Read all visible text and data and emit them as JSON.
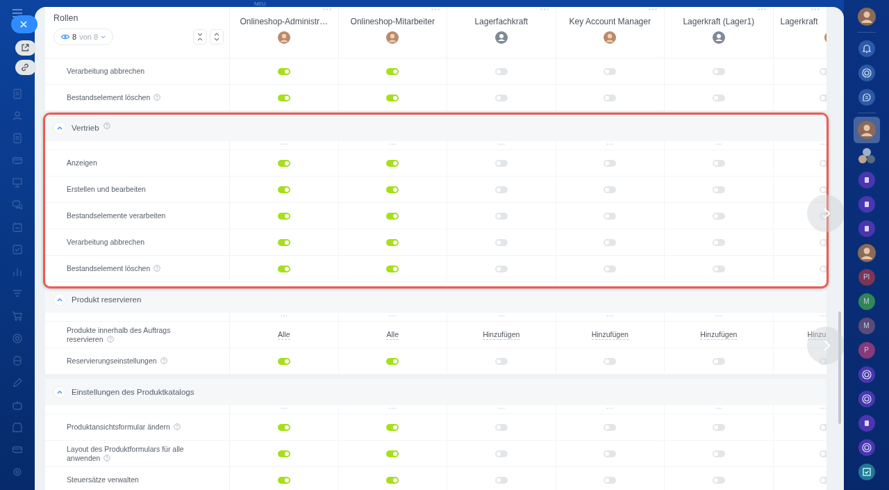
{
  "top_label": "NEU",
  "header_title": "Rollen",
  "filter": {
    "count": "8",
    "total": "von 8"
  },
  "roles": [
    {
      "name": "Onlineshop-Administr…",
      "kind": "photo"
    },
    {
      "name": "Onlineshop-Mitarbeiter",
      "kind": "photo"
    },
    {
      "name": "Lagerfachkraft",
      "kind": "placeholder"
    },
    {
      "name": "Key Account Manager",
      "kind": "photo"
    },
    {
      "name": "Lagerkraft (Lager1)",
      "kind": "placeholder"
    },
    {
      "name": "Lagerkraft",
      "kind": "photo"
    }
  ],
  "sections": [
    {
      "highlighted": false,
      "rows": [
        {
          "label": "Verarbeitung abbrechen",
          "help": false,
          "cells": [
            {
              "kind": "toggle",
              "on": true
            },
            {
              "kind": "toggle",
              "on": true
            },
            {
              "kind": "toggle",
              "on": false
            },
            {
              "kind": "toggle",
              "on": false
            },
            {
              "kind": "toggle",
              "on": false
            },
            {
              "kind": "toggle",
              "on": false
            }
          ]
        },
        {
          "label": "Bestandselement löschen",
          "help": true,
          "cells": [
            {
              "kind": "toggle",
              "on": true
            },
            {
              "kind": "toggle",
              "on": true
            },
            {
              "kind": "toggle",
              "on": false
            },
            {
              "kind": "toggle",
              "on": false
            },
            {
              "kind": "toggle",
              "on": false
            },
            {
              "kind": "toggle",
              "on": false
            }
          ]
        }
      ]
    },
    {
      "title": "Vertrieb",
      "help": true,
      "expanded": true,
      "highlighted": true,
      "rows": [
        {
          "label": "Anzeigen",
          "help": false,
          "cells": [
            {
              "kind": "toggle",
              "on": true
            },
            {
              "kind": "toggle",
              "on": true
            },
            {
              "kind": "toggle",
              "on": false
            },
            {
              "kind": "toggle",
              "on": false
            },
            {
              "kind": "toggle",
              "on": false
            },
            {
              "kind": "toggle",
              "on": false
            }
          ]
        },
        {
          "label": "Erstellen und bearbeiten",
          "help": false,
          "cells": [
            {
              "kind": "toggle",
              "on": true
            },
            {
              "kind": "toggle",
              "on": true
            },
            {
              "kind": "toggle",
              "on": false
            },
            {
              "kind": "toggle",
              "on": false
            },
            {
              "kind": "toggle",
              "on": false
            },
            {
              "kind": "toggle",
              "on": false
            }
          ]
        },
        {
          "label": "Bestandselemente verarbeiten",
          "help": false,
          "cells": [
            {
              "kind": "toggle",
              "on": true
            },
            {
              "kind": "toggle",
              "on": true
            },
            {
              "kind": "toggle",
              "on": false
            },
            {
              "kind": "toggle",
              "on": false
            },
            {
              "kind": "toggle",
              "on": false
            },
            {
              "kind": "toggle",
              "on": false
            }
          ]
        },
        {
          "label": "Verarbeitung abbrechen",
          "help": false,
          "cells": [
            {
              "kind": "toggle",
              "on": true
            },
            {
              "kind": "toggle",
              "on": true
            },
            {
              "kind": "toggle",
              "on": false
            },
            {
              "kind": "toggle",
              "on": false
            },
            {
              "kind": "toggle",
              "on": false
            },
            {
              "kind": "toggle",
              "on": false
            }
          ]
        },
        {
          "label": "Bestandselement löschen",
          "help": true,
          "cells": [
            {
              "kind": "toggle",
              "on": true
            },
            {
              "kind": "toggle",
              "on": true
            },
            {
              "kind": "toggle",
              "on": false
            },
            {
              "kind": "toggle",
              "on": false
            },
            {
              "kind": "toggle",
              "on": false
            },
            {
              "kind": "toggle",
              "on": false
            }
          ]
        }
      ]
    },
    {
      "title": "Produkt reservieren",
      "help": false,
      "expanded": true,
      "highlighted": false,
      "rows": [
        {
          "label": "Produkte innerhalb des Auftrags reservieren",
          "help": true,
          "cells": [
            {
              "kind": "text",
              "value": "Alle"
            },
            {
              "kind": "text",
              "value": "Alle"
            },
            {
              "kind": "text",
              "value": "Hinzufügen"
            },
            {
              "kind": "text",
              "value": "Hinzufügen"
            },
            {
              "kind": "text",
              "value": "Hinzufügen"
            },
            {
              "kind": "text",
              "value": "Hinzu"
            }
          ]
        },
        {
          "label": "Reservierungseinstellungen",
          "help": true,
          "cells": [
            {
              "kind": "toggle",
              "on": true
            },
            {
              "kind": "toggle",
              "on": true
            },
            {
              "kind": "toggle",
              "on": false
            },
            {
              "kind": "toggle",
              "on": false
            },
            {
              "kind": "toggle",
              "on": false
            },
            {
              "kind": "toggle",
              "on": false
            }
          ]
        }
      ]
    },
    {
      "title": "Einstellungen des Produktkatalogs",
      "help": false,
      "expanded": true,
      "highlighted": false,
      "rows": [
        {
          "label": "Produktansichtsformular ändern",
          "help": true,
          "cells": [
            {
              "kind": "toggle",
              "on": true
            },
            {
              "kind": "toggle",
              "on": true
            },
            {
              "kind": "toggle",
              "on": false
            },
            {
              "kind": "toggle",
              "on": false
            },
            {
              "kind": "toggle",
              "on": false
            },
            {
              "kind": "toggle",
              "on": false
            }
          ]
        },
        {
          "label": "Layout des Produktformulars für alle anwenden",
          "help": true,
          "cells": [
            {
              "kind": "toggle",
              "on": true
            },
            {
              "kind": "toggle",
              "on": true
            },
            {
              "kind": "toggle",
              "on": false
            },
            {
              "kind": "toggle",
              "on": false
            },
            {
              "kind": "toggle",
              "on": false
            },
            {
              "kind": "toggle",
              "on": false
            }
          ]
        },
        {
          "label": "Steuersätze verwalten",
          "help": false,
          "cells": [
            {
              "kind": "toggle",
              "on": true
            },
            {
              "kind": "toggle",
              "on": true
            },
            {
              "kind": "toggle",
              "on": false
            },
            {
              "kind": "toggle",
              "on": false
            },
            {
              "kind": "toggle",
              "on": false
            },
            {
              "kind": "toggle",
              "on": false
            }
          ]
        }
      ]
    }
  ],
  "right_bar": [
    [
      {
        "kind": "avatar",
        "selected": false
      }
    ],
    [
      {
        "kind": "bell",
        "selected": false
      },
      {
        "kind": "swirl",
        "selected": false
      },
      {
        "kind": "chat",
        "selected": false
      }
    ],
    [
      {
        "kind": "avatar",
        "selected": true
      },
      {
        "kind": "group",
        "selected": false
      },
      {
        "kind": "contact",
        "selected": false
      },
      {
        "kind": "contact",
        "selected": false
      },
      {
        "kind": "contact",
        "selected": false
      },
      {
        "kind": "avatar",
        "selected": false
      },
      {
        "kind": "initials",
        "text": "Pl",
        "color": "#7a3656",
        "selected": false
      },
      {
        "kind": "initials",
        "text": "M",
        "color": "#2f8656",
        "selected": false
      },
      {
        "kind": "initials",
        "text": "M",
        "color": "#5a4c78",
        "selected": false
      },
      {
        "kind": "initials",
        "text": "P",
        "color": "#873a78",
        "selected": false
      },
      {
        "kind": "swirl",
        "selected": false
      },
      {
        "kind": "swirl",
        "selected": false
      },
      {
        "kind": "contact",
        "selected": false
      },
      {
        "kind": "swirl",
        "selected": false
      },
      {
        "kind": "task",
        "selected": false
      }
    ]
  ]
}
